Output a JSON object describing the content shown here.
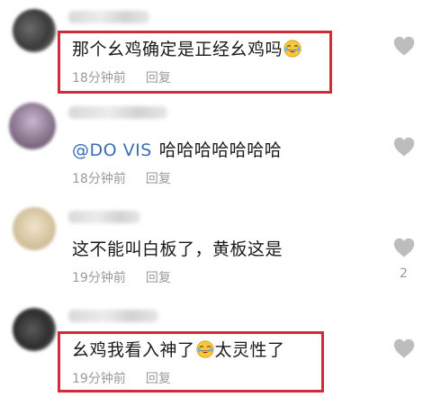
{
  "comments": [
    {
      "text_before": "那个幺鸡确定是正经幺鸡吗",
      "emoji": "crying-laughing-emoji",
      "text_after": "",
      "time": "18分钟前",
      "reply_label": "回复",
      "likes": ""
    },
    {
      "mention": "@DO VIS",
      "text_before": "哈哈哈哈哈哈哈",
      "time": "18分钟前",
      "reply_label": "回复",
      "likes": ""
    },
    {
      "text_before": "这不能叫白板了，黄板这是",
      "time": "19分钟前",
      "reply_label": "回复",
      "likes": "2"
    },
    {
      "text_before": "幺鸡我看入神了",
      "emoji": "crying-laughing-emoji",
      "text_after": "太灵性了",
      "time": "19分钟前",
      "reply_label": "回复",
      "likes": ""
    }
  ],
  "colors": {
    "highlight": "#d02a3b",
    "meta_text": "#9a9a9a",
    "mention": "#3a6db5",
    "heart": "#bdbdbd"
  },
  "icons": [
    "heart-icon",
    "crying-laughing-emoji"
  ]
}
